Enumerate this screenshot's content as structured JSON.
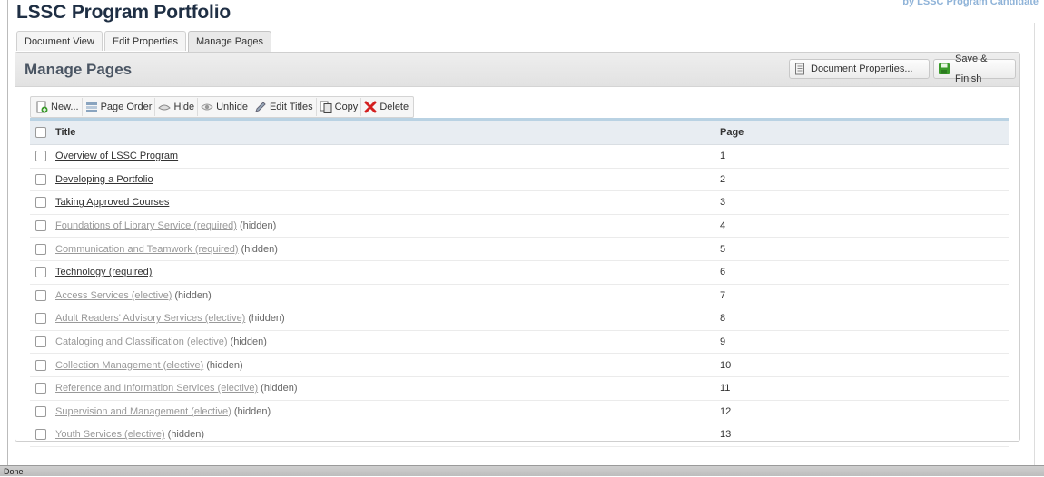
{
  "app": {
    "title": "LSSC Program Portfolio",
    "byline": "by LSSC Program Candidate"
  },
  "tabs": [
    {
      "label": "Document View",
      "active": false
    },
    {
      "label": "Edit Properties",
      "active": false
    },
    {
      "label": "Manage Pages",
      "active": true
    }
  ],
  "panel": {
    "title": "Manage Pages",
    "document_properties_label": "Document Properties...",
    "save_finish_label": "Save & Finish"
  },
  "toolbar": {
    "new_label": "New...",
    "page_order_label": "Page Order",
    "hide_label": "Hide",
    "unhide_label": "Unhide",
    "edit_titles_label": "Edit Titles",
    "copy_label": "Copy",
    "delete_label": "Delete"
  },
  "table": {
    "columns": {
      "title": "Title",
      "page": "Page"
    },
    "rows": [
      {
        "title": "Overview of LSSC Program",
        "suffix": "",
        "page": "1",
        "hidden": false
      },
      {
        "title": "Developing a Portfolio",
        "suffix": "",
        "page": "2",
        "hidden": false
      },
      {
        "title": "Taking Approved Courses",
        "suffix": "",
        "page": "3",
        "hidden": false
      },
      {
        "title": "Foundations of Library Service (required)",
        "suffix": "(hidden)",
        "page": "4",
        "hidden": true
      },
      {
        "title": "Communication and Teamwork (required)",
        "suffix": "(hidden)",
        "page": "5",
        "hidden": true
      },
      {
        "title": "Technology (required)",
        "suffix": "",
        "page": "6",
        "hidden": false
      },
      {
        "title": "Access Services (elective)",
        "suffix": "(hidden)",
        "page": "7",
        "hidden": true
      },
      {
        "title": "Adult Readers' Advisory Services (elective)",
        "suffix": "(hidden)",
        "page": "8",
        "hidden": true
      },
      {
        "title": "Cataloging and Classification (elective)",
        "suffix": "(hidden)",
        "page": "9",
        "hidden": true
      },
      {
        "title": "Collection Management (elective)",
        "suffix": "(hidden)",
        "page": "10",
        "hidden": true
      },
      {
        "title": "Reference and Information Services (elective)",
        "suffix": "(hidden)",
        "page": "11",
        "hidden": true
      },
      {
        "title": "Supervision and Management (elective)",
        "suffix": "(hidden)",
        "page": "12",
        "hidden": true
      },
      {
        "title": "Youth Services (elective)",
        "suffix": "(hidden)",
        "page": "13",
        "hidden": true
      }
    ]
  },
  "status": {
    "text": "Done"
  },
  "colors": {
    "save_green": "#3a9a2a",
    "delete_red": "#d42020",
    "grid_rule": "#b9d2e3"
  },
  "icons": {
    "new": "new-page-icon",
    "page_order": "page-order-icon",
    "hide": "hide-icon",
    "unhide": "unhide-icon",
    "edit_titles": "pencil-icon",
    "copy": "copy-icon",
    "delete": "delete-x-icon",
    "document_properties": "document-icon",
    "save": "save-icon"
  }
}
